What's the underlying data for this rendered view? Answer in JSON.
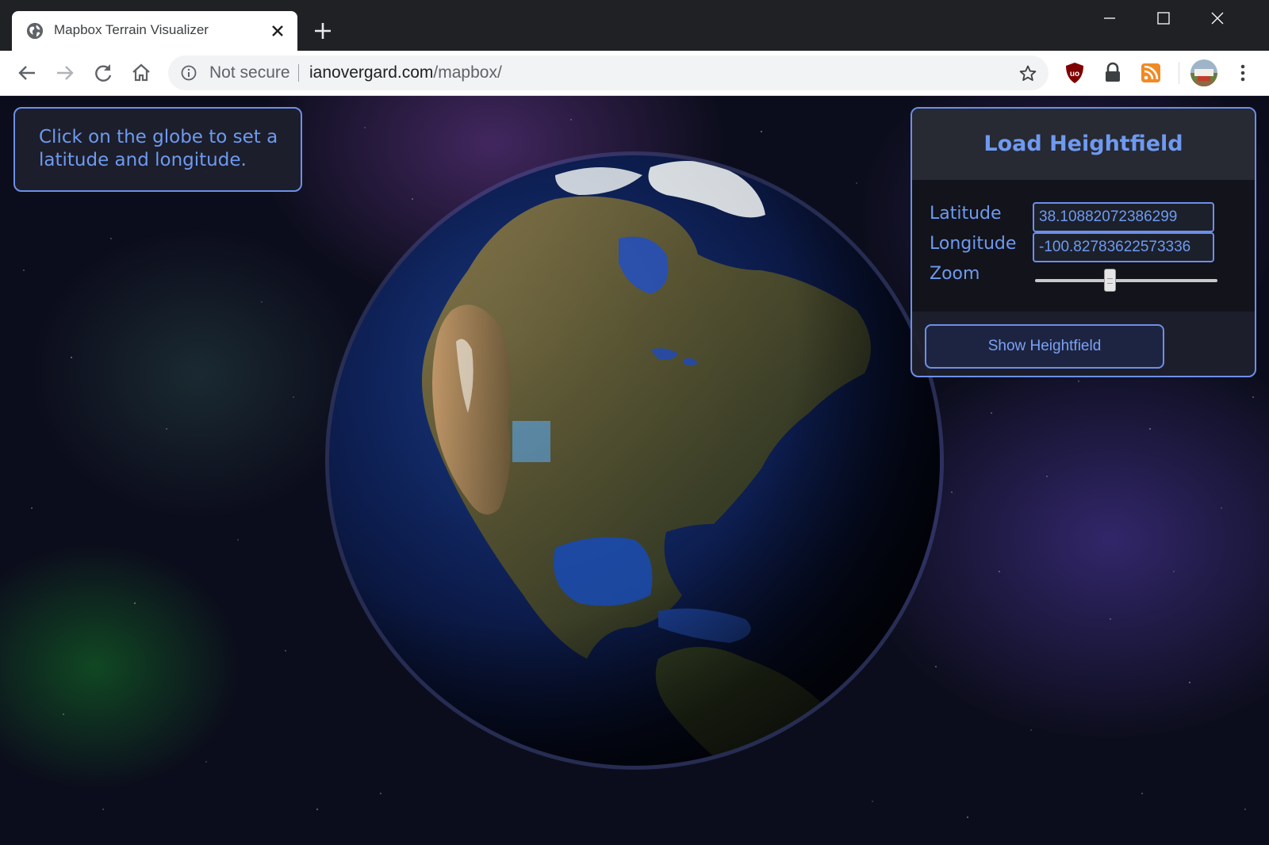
{
  "browser": {
    "tab_title": "Mapbox Terrain Visualizer",
    "security_label": "Not secure",
    "url_host": "ianovergard.com",
    "url_path": "/mapbox/"
  },
  "icons": {
    "tab_favicon": "globe-icon",
    "tab_close": "close-icon",
    "new_tab": "plus-icon",
    "minimize": "minimize-icon",
    "maximize": "maximize-icon",
    "close_window": "close-icon",
    "back": "back-arrow-icon",
    "forward": "forward-arrow-icon",
    "reload": "reload-icon",
    "home": "home-icon",
    "site_info": "info-icon",
    "bookmark": "star-icon",
    "ublock": "ublock-shield-icon",
    "lock_extension": "lock-icon",
    "rss": "rss-icon",
    "profile": "avatar-icon",
    "menu": "kebab-menu-icon"
  },
  "hint": {
    "text": "Click on the globe to set a latitude and longitude."
  },
  "load_panel": {
    "title": "Load Heightfield",
    "latitude_label": "Latitude",
    "latitude_value": "38.10882072386299",
    "longitude_label": "Longitude",
    "longitude_value": "-100.82783622573336",
    "zoom_label": "Zoom",
    "zoom_fraction": 0.41,
    "button_label": "Show Heightfield"
  },
  "colors": {
    "accent": "#6e9af0",
    "panel_border": "#6d8fe8",
    "chrome_dark": "#202124"
  }
}
